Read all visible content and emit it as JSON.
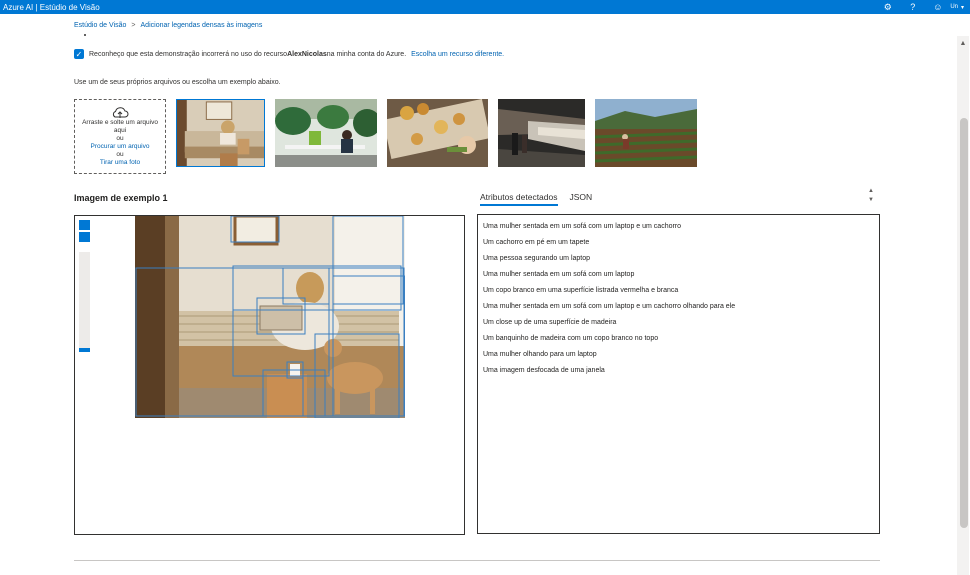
{
  "topbar": {
    "title": "Azure AI | Estúdio de Visão",
    "icons": [
      "gear-icon",
      "help-icon",
      "feedback-icon"
    ],
    "user_initials": "Un",
    "accent": "#0078d4"
  },
  "breadcrumb": [
    "Estúdio de Visão",
    "Adicionar legendas densas às imagens"
  ],
  "consent": {
    "checked": true,
    "text_before": "Reconheço que esta demonstração incorrerá no uso do recurso ",
    "resource": "AlexNicolas",
    "text_after": " na minha conta do Azure.",
    "link": "Escolha um recurso diferente."
  },
  "instruction": "Use um de seus próprios arquivos ou escolha um exemplo abaixo.",
  "upload": {
    "icon": "cloud-upload-icon",
    "line1": "Arraste e solte um arquivo aqui",
    "or1": "ou",
    "browse": "Procurar um arquivo",
    "or2": "ou",
    "photo": "Tirar uma foto"
  },
  "samples": [
    "woman-sofa-laptop-dog",
    "office-plants",
    "food-table",
    "subway-train",
    "farm-field"
  ],
  "section_title": "Imagem de exemplo 1",
  "tabs": [
    "Atributos detectados",
    "JSON"
  ],
  "active_tab": "Atributos detectados",
  "attributes": [
    "Uma mulher sentada em um sofá com um laptop e um cachorro",
    "Um cachorro em pé em um tapete",
    "Uma pessoa segurando um laptop",
    "Uma mulher sentada em um sofá com um laptop",
    "Um copo branco em uma superfície listrada vermelha e branca",
    "Uma mulher sentada em um sofá com um laptop e um cachorro olhando para ele",
    "Um close up de uma superfície de madeira",
    "Um banquinho de madeira com um copo branco no topo",
    "Uma mulher olhando para um laptop",
    "Uma imagem desfocada de uma janela"
  ],
  "zoom_level": 0.05
}
